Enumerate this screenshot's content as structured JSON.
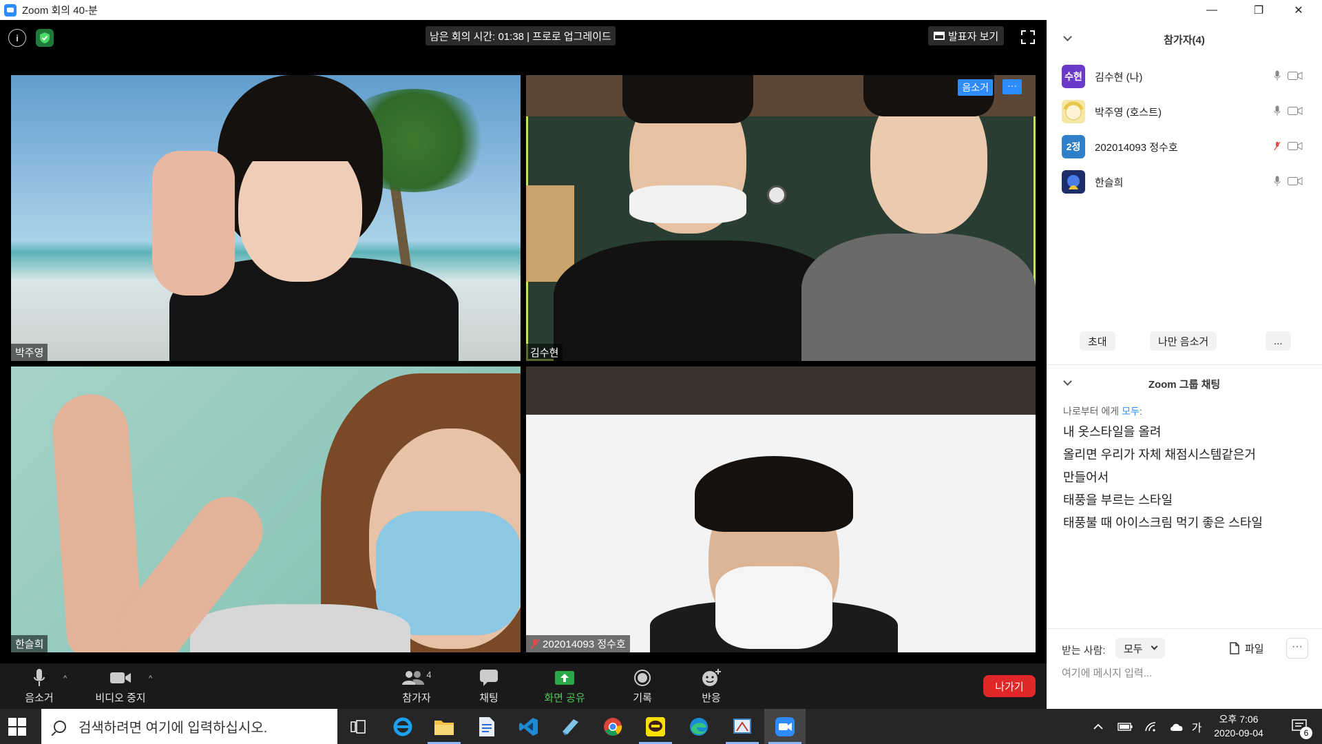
{
  "window": {
    "title": "Zoom 회의 40-분",
    "min": "—",
    "restore": "❐",
    "close": "✕"
  },
  "meeting": {
    "timer": "남은 회의 시간: 01:38 | 프로로 업그레이드",
    "speaker_view": "발표자 보기",
    "tiles": [
      {
        "name": "박주영"
      },
      {
        "name": "김수현",
        "mute_label": "음소거",
        "more": "···"
      },
      {
        "name": "한슬희"
      },
      {
        "name": "202014093 정수호"
      }
    ]
  },
  "toolbar": {
    "mute": "음소거",
    "video": "비디오 중지",
    "participants": "참가자",
    "participants_count": "4",
    "chat": "채팅",
    "share": "화면 공유",
    "record": "기록",
    "reactions": "반응",
    "leave": "나가기"
  },
  "participants_panel": {
    "title": "참가자(4)",
    "items": [
      {
        "name": "김수현 (나)",
        "avatar": "수현",
        "color": "#6c3ac9",
        "muted": false
      },
      {
        "name": "박주영 (호스트)",
        "avatar": "",
        "color": "#f6e7a4",
        "muted": false
      },
      {
        "name": "202014093 정수호",
        "avatar": "2정",
        "color": "#2f7fc9",
        "muted": true
      },
      {
        "name": "한슬희",
        "avatar": "",
        "color": "#1d2d6a",
        "muted": false
      }
    ],
    "invite": "초대",
    "mute_all": "나만 음소거",
    "more": "..."
  },
  "chat": {
    "title": "Zoom 그룹 채팅",
    "from": "나로부터 에게",
    "to": "모두",
    "messages": [
      "내 옷스타일을 올려",
      "올리면 우리가 자체 채점시스템같은거",
      "만들어서",
      "태풍을 부르는 스타일",
      "태풍불 때 아이스크림 먹기 좋은 스타일"
    ],
    "recipient_label": "받는 사람:",
    "recipient": "모두",
    "file": "파일",
    "more": "···",
    "input_placeholder": "여기에 메시지 입력..."
  },
  "taskbar": {
    "search_placeholder": "검색하려면 여기에 입력하십시오.",
    "ime": "가",
    "time": "오후 7:06",
    "date": "2020-09-04",
    "notifications": "6"
  }
}
